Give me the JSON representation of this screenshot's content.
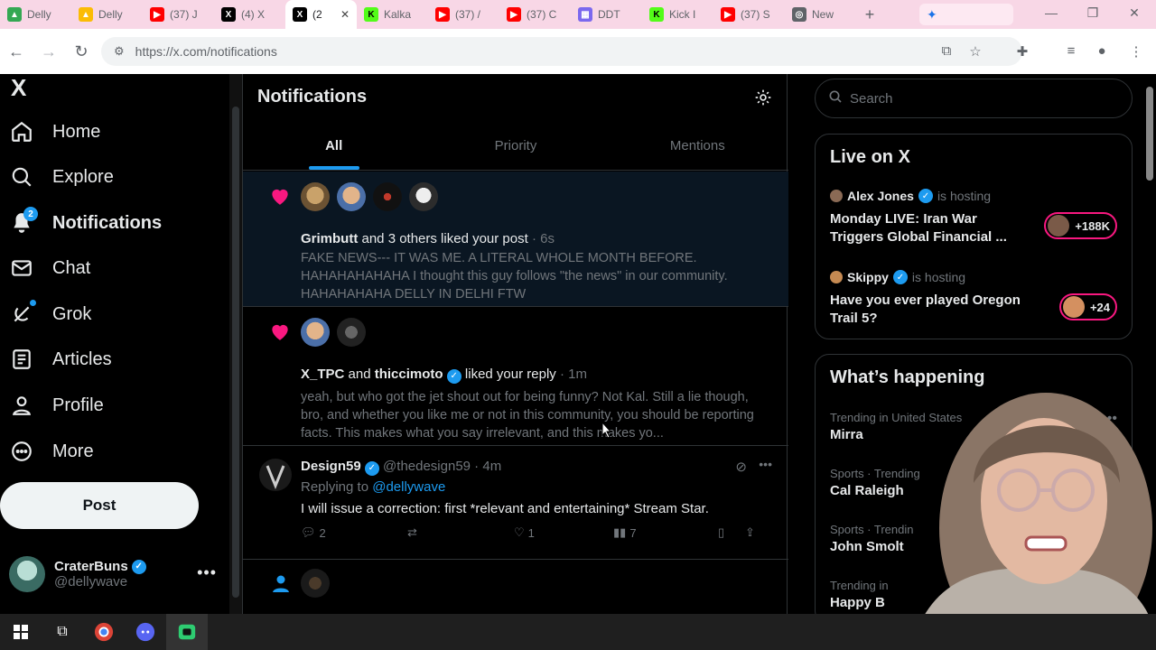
{
  "browser": {
    "tabs": [
      {
        "title": "Delly",
        "favicon": "google-drive-icon",
        "color": "#34a853"
      },
      {
        "title": "Delly",
        "favicon": "google-drive-icon",
        "color": "#fbbc04"
      },
      {
        "title": "(37) J",
        "favicon": "youtube-icon",
        "color": "#ff0000"
      },
      {
        "title": "(4) X",
        "favicon": "x-icon",
        "color": "#000000"
      },
      {
        "title": "(2",
        "favicon": "x-icon",
        "color": "#000000",
        "active": true
      },
      {
        "title": "Kalka",
        "favicon": "kick-icon",
        "color": "#53fc18"
      },
      {
        "title": "(37) /",
        "favicon": "youtube-icon",
        "color": "#ff0000"
      },
      {
        "title": "(37) C",
        "favicon": "youtube-icon",
        "color": "#ff0000"
      },
      {
        "title": "DDT",
        "favicon": "calendar-icon",
        "color": "#7b68ee"
      },
      {
        "title": "Kick I",
        "favicon": "kick-icon",
        "color": "#53fc18"
      },
      {
        "title": "(37) S",
        "favicon": "youtube-icon",
        "color": "#ff0000"
      },
      {
        "title": "New",
        "favicon": "chrome-icon",
        "color": "#5f6368"
      }
    ],
    "url": "https://x.com/notifications"
  },
  "nav": {
    "logo": "X",
    "items": [
      {
        "label": "Home",
        "icon": "home-icon"
      },
      {
        "label": "Explore",
        "icon": "search-icon"
      },
      {
        "label": "Notifications",
        "icon": "bell-icon",
        "badge": "2"
      },
      {
        "label": "Chat",
        "icon": "mail-icon"
      },
      {
        "label": "Grok",
        "icon": "grok-icon"
      },
      {
        "label": "Articles",
        "icon": "articles-icon"
      },
      {
        "label": "Profile",
        "icon": "person-icon"
      },
      {
        "label": "More",
        "icon": "more-circle-icon"
      }
    ],
    "post_label": "Post",
    "account": {
      "name": "CraterBuns",
      "handle": "@dellywave"
    }
  },
  "main": {
    "title": "Notifications",
    "tabs": [
      "All",
      "Priority",
      "Mentions"
    ],
    "notif1": {
      "who": "Grimbutt",
      "rest": " and 3 others liked your post",
      "time": " · 6s",
      "text": "FAKE NEWS--- IT WAS ME.  A LITERAL WHOLE MONTH BEFORE.  HAHAHAHAHAHA  I thought this guy follows \"the news\" in our community.  HAHAHAHAHA DELLY IN DELHI FTW"
    },
    "notif2": {
      "who1": "X_TPC",
      "and": " and ",
      "who2": "thiccimoto",
      "rest": " liked your reply",
      "time": " · 1m",
      "text": "yeah, but who got the jet shout out for being funny?  Not Kal.  Still a lie though, bro, and whether you like me or not in this community, you should be reporting facts.  This makes what you say irrelevant, and this makes yo..."
    },
    "reply": {
      "name": "Design59",
      "handle": "@thedesign59",
      "time": " · 4m",
      "replying_prefix": "Replying to ",
      "replying_to": "@dellywave",
      "text": "I will issue a correction: first *relevant and entertaining* Stream Star.",
      "replies": "2",
      "likes": "1",
      "views": "7"
    }
  },
  "right": {
    "search_placeholder": "Search",
    "live": {
      "title": "Live on X",
      "hosting": "is hosting",
      "items": [
        {
          "host": "Alex Jones",
          "title": "Monday LIVE: Iran War Triggers Global Financial ...",
          "count": "+188K"
        },
        {
          "host": "Skippy",
          "title": "Have you ever played Oregon Trail 5?",
          "count": "+24"
        }
      ]
    },
    "happening": {
      "title": "What’s happening",
      "trends": [
        {
          "meta": "Trending in United States",
          "name": "Mirra"
        },
        {
          "meta": "Sports · Trending",
          "name": "Cal Raleigh"
        },
        {
          "meta": "Sports · Trendin",
          "name": "John Smolt"
        },
        {
          "meta": "Trending in",
          "name": "Happy B"
        }
      ]
    }
  },
  "colors": {
    "accent": "#1d9bf0",
    "like": "#f91880",
    "live": "#f91880"
  }
}
